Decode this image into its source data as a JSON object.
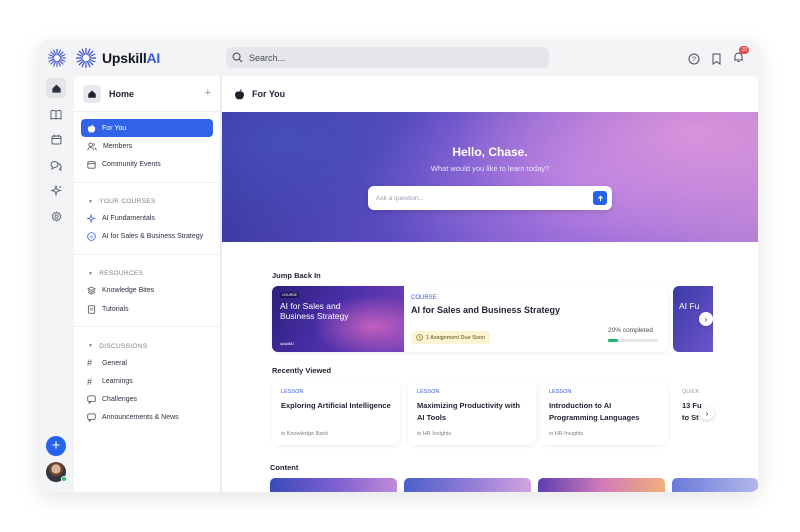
{
  "brand": {
    "name": "Upskill",
    "name_accent": "AI"
  },
  "search": {
    "placeholder": "Search..."
  },
  "notifications": {
    "count": "10"
  },
  "rail": {
    "items": [
      {
        "name": "home",
        "icon": "home-icon",
        "active": true
      },
      {
        "name": "courses",
        "icon": "book-icon"
      },
      {
        "name": "calendar",
        "icon": "calendar-icon"
      },
      {
        "name": "chat",
        "icon": "chat-bubbles-icon"
      },
      {
        "name": "sparkle",
        "icon": "sparkle-icon"
      },
      {
        "name": "settings",
        "icon": "gear-icon"
      }
    ]
  },
  "sidebar": {
    "title": "Home",
    "main_items": [
      {
        "label": "For You",
        "icon": "apple-icon",
        "active": true
      },
      {
        "label": "Members",
        "icon": "users-icon"
      },
      {
        "label": "Community Events",
        "icon": "calendar-icon"
      }
    ],
    "your_courses": {
      "heading": "YOUR COURSES",
      "items": [
        {
          "label": "AI Fundamentals",
          "icon": "sparkle-icon"
        },
        {
          "label": "AI for Sales & Business Strategy",
          "icon": "ai-badge-icon"
        }
      ]
    },
    "resources": {
      "heading": "RESOURCES",
      "items": [
        {
          "label": "Knowledge Bites",
          "icon": "layers-icon"
        },
        {
          "label": "Tutorials",
          "icon": "document-icon"
        }
      ]
    },
    "discussions": {
      "heading": "DISCUSSIONS",
      "items": [
        {
          "label": "General",
          "icon": "hash-icon"
        },
        {
          "label": "Learnings",
          "icon": "hash-icon"
        },
        {
          "label": "Challenges",
          "icon": "chat-icon"
        },
        {
          "label": "Announcements & News",
          "icon": "chat-icon"
        }
      ]
    }
  },
  "main": {
    "title": "For You",
    "hero": {
      "greeting": "Hello, Chase.",
      "subtitle": "What would you like to learn today?",
      "ask_placeholder": "Ask a question..."
    },
    "jump_back_in": {
      "heading": "Jump Back In",
      "card": {
        "thumb_tag": "COURSE",
        "thumb_title": "AI for Sales and Business Strategy",
        "thumb_brand": "UpskillAI",
        "kicker": "COURSE",
        "title": "AI for Sales and Business Strategy",
        "due": "1 Assignment Due Soon",
        "progress_label": "20% completed",
        "progress": 0.2
      },
      "peek_title": "AI Fu"
    },
    "recently_viewed": {
      "heading": "Recently Viewed",
      "cards": [
        {
          "kicker": "LESSON",
          "title": "Exploring Artificial Intelligence",
          "meta": "in Knowledge Bank"
        },
        {
          "kicker": "LESSON",
          "title": "Maximizing Productivity with AI Tools",
          "meta": "in HR Insights"
        },
        {
          "kicker": "LESSON",
          "title": "Introduction to AI Programming Languages",
          "meta": "in HR Insights"
        }
      ],
      "peek": {
        "kicker": "QUICK",
        "title": "13 Fu to St"
      }
    },
    "content": {
      "heading": "Content"
    }
  }
}
